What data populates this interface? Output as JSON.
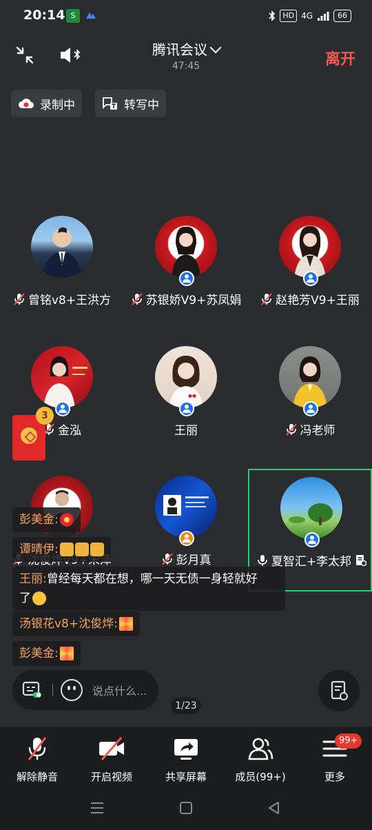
{
  "status_bar": {
    "time": "20:14",
    "app_icon_1": "S",
    "network": "4G",
    "hd": "HD",
    "battery": "66"
  },
  "header": {
    "title": "腾讯会议",
    "timer": "47:45",
    "leave_label": "离开"
  },
  "chips": {
    "recording": "录制中",
    "transcribing": "转写中"
  },
  "participants": [
    {
      "name": "曾铭v8+王洪方",
      "muted": true,
      "badge": "none"
    },
    {
      "name": "苏银娇V9+苏凤娟",
      "muted": true,
      "badge": "blue"
    },
    {
      "name": "赵艳芳V9+王丽",
      "muted": true,
      "badge": "blue"
    },
    {
      "name": "金泓",
      "muted": true,
      "badge": "blue"
    },
    {
      "name": "王丽",
      "muted": false,
      "badge": "blue"
    },
    {
      "name": "冯老师",
      "muted": true,
      "badge": "blue"
    },
    {
      "name": "沈俊烨V9+宋泽",
      "muted": true,
      "badge": "none"
    },
    {
      "name": "彭月真",
      "muted": true,
      "badge": "orange"
    },
    {
      "name": "夏智汇+李太邦",
      "muted": false,
      "badge": "blue"
    }
  ],
  "red_packet": {
    "count": "3"
  },
  "chat": [
    {
      "nick": "彭美金:",
      "text": ""
    },
    {
      "nick": "谭晴伊:",
      "text": ""
    },
    {
      "nick": "王丽:",
      "text": "曾经每天都在想，哪一天无债一身轻就好",
      "text2": "了"
    },
    {
      "nick": "汤银花v8+沈俊烨:",
      "text": ""
    },
    {
      "nick": "彭美金:",
      "text": ""
    }
  ],
  "input": {
    "placeholder": "说点什么..."
  },
  "page_indicator": "1/23",
  "toolbar": {
    "unmute": "解除静音",
    "video": "开启视频",
    "share": "共享屏幕",
    "members": "成员(99+)",
    "more": "更多",
    "more_badge": "99+"
  },
  "colors": {
    "background": "#2b2c2f",
    "accent_red": "#f2564f",
    "nick_orange": "#f3a35a",
    "active_border": "#2ecb72",
    "badge_blue": "#1e73e8"
  }
}
